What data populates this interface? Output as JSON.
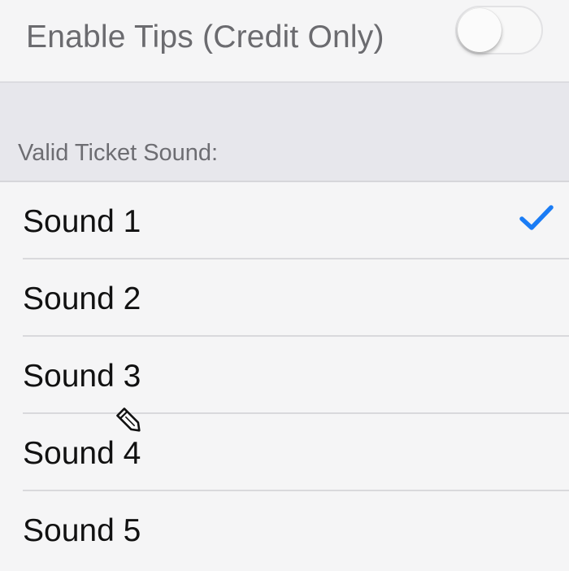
{
  "tips": {
    "label": "Enable Tips (Credit Only)",
    "enabled": false
  },
  "section": {
    "header": "Valid Ticket Sound:"
  },
  "sounds": [
    {
      "label": "Sound 1",
      "selected": true
    },
    {
      "label": "Sound 2",
      "selected": false
    },
    {
      "label": "Sound 3",
      "selected": false
    },
    {
      "label": "Sound 4",
      "selected": false
    },
    {
      "label": "Sound 5",
      "selected": false
    }
  ],
  "icons": {
    "check": "checkmark-icon",
    "cursor": "pencil-cursor-icon"
  },
  "colors": {
    "accent": "#1a7cf5",
    "background": "#f5f5f6",
    "section_background": "#e7e7ec",
    "separator": "#d9d9dc"
  }
}
